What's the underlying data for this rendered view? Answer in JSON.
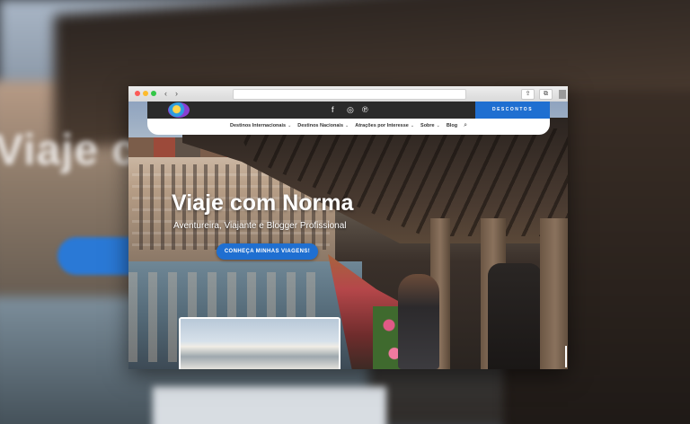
{
  "backdrop": {
    "blurred_title": "Viaje c"
  },
  "browser": {
    "url": "",
    "nav_back": "‹",
    "nav_forward": "›",
    "share_icon": "⇪",
    "tabs_icon": "⧉"
  },
  "header": {
    "social": [
      "f",
      "◎",
      "℗"
    ],
    "descontos": "DESCONTOS",
    "menu": [
      {
        "label": "Destinos Internacionais",
        "chevron": "⌄"
      },
      {
        "label": "Destinos Nacionais",
        "chevron": "⌄"
      },
      {
        "label": "Atrações por Interesse",
        "chevron": "⌄"
      },
      {
        "label": "Sobre",
        "chevron": "⌄"
      },
      {
        "label": "Blog"
      }
    ],
    "search_icon": "⌕"
  },
  "hero": {
    "title": "Viaje com Norma",
    "subtitle": "Aventureira, Viajante e Blogger Profissional",
    "cta": "CONHEÇA MINHAS VIAGENS!"
  },
  "colors": {
    "accent": "#1f6fd1",
    "topbar": "#2a2a2a"
  }
}
